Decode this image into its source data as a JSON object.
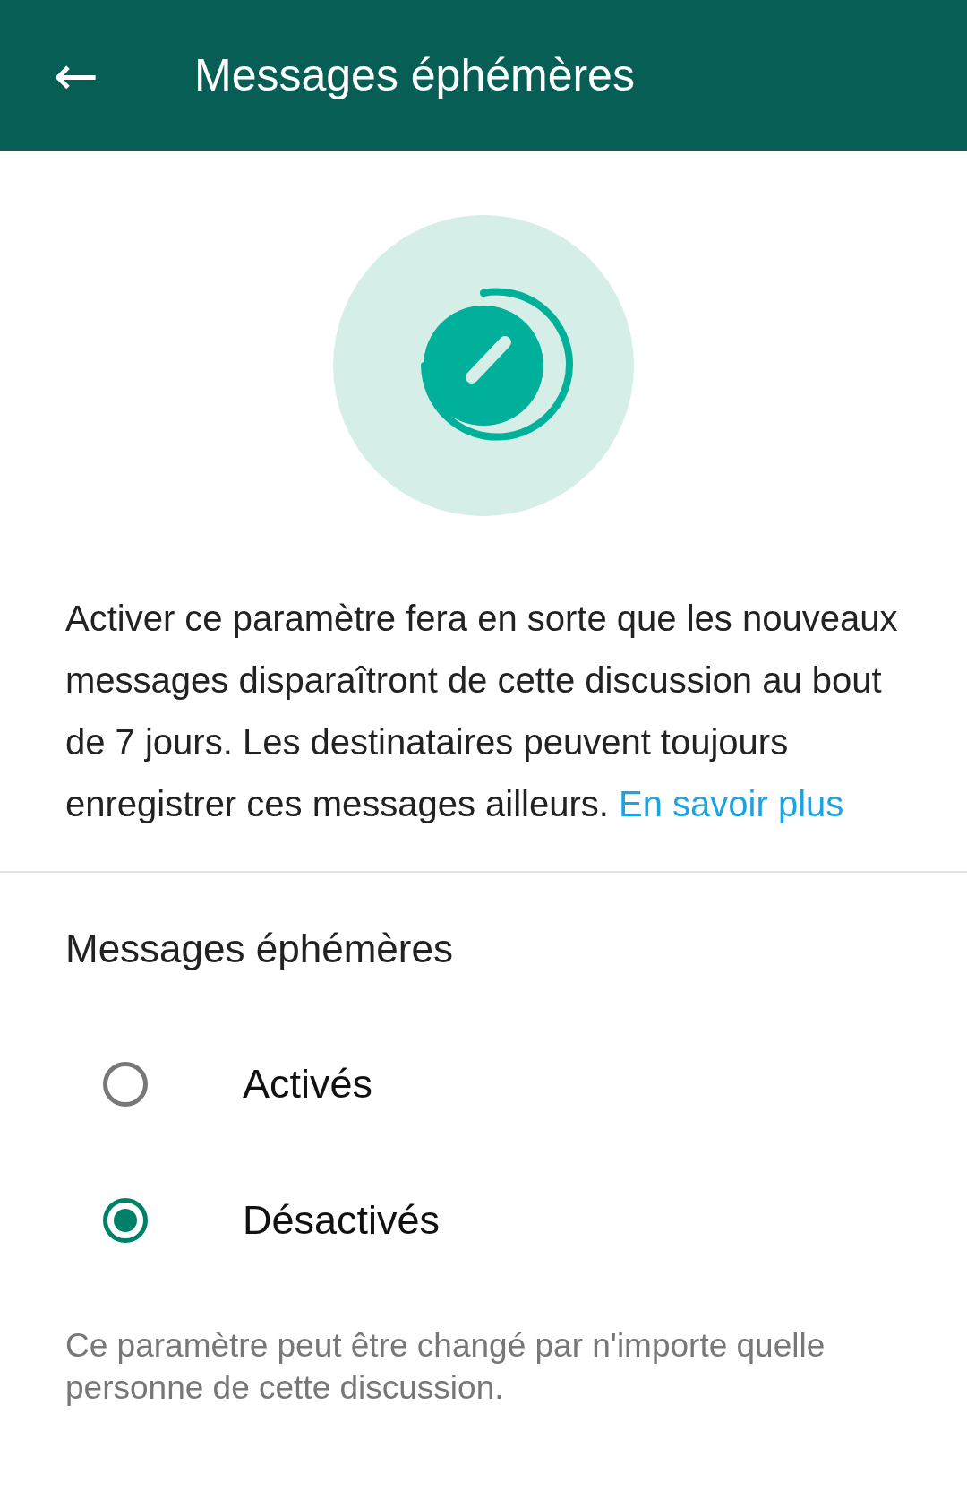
{
  "app_bar": {
    "back_icon": "←",
    "title": "Messages éphémères"
  },
  "description": {
    "text": "Activer ce paramètre fera en sorte que les nouveaux messages disparaîtront de cette discussion au bout de 7 jours. Les destinataires peuvent toujours enregistrer ces messages ailleurs.",
    "link": "En savoir plus"
  },
  "section_title": "Messages éphémères",
  "options": [
    {
      "label": "Activés",
      "selected": false
    },
    {
      "label": "Désactivés",
      "selected": true
    }
  ],
  "footer_note": "Ce paramètre peut être changé par n'importe quelle personne de cette discussion."
}
